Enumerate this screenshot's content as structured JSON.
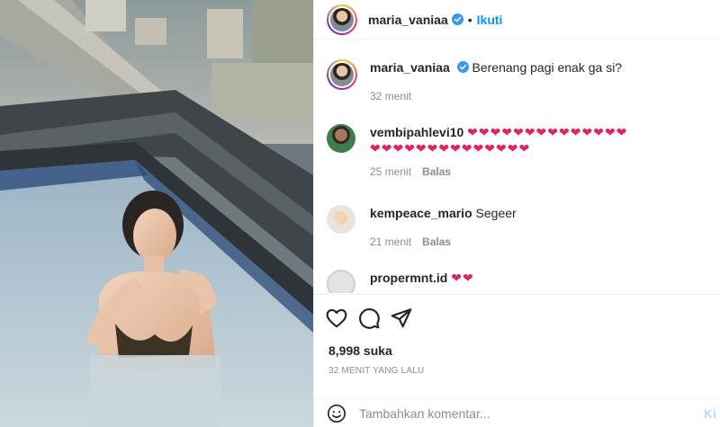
{
  "header": {
    "username": "maria_vaniaa",
    "separator": "•",
    "follow_label": "Ikuti"
  },
  "caption": {
    "username": "maria_vaniaa",
    "text": "Berenang pagi enak ga si?",
    "time": "32 menit"
  },
  "comments": [
    {
      "username": "vembipahlevi10",
      "text": "❤❤❤❤❤❤❤❤❤❤❤❤❤❤❤❤❤❤❤❤❤❤❤❤❤❤❤❤❤❤❤❤❤❤❤❤❤❤❤❤❤❤❤❤❤❤❤❤❤❤❤❤❤❤❤❤❤❤❤❤❤❤❤❤",
      "line1": "❤❤❤❤❤❤❤❤❤❤❤❤❤❤❤❤❤❤❤❤❤❤❤❤❤❤❤❤❤❤❤❤❤❤❤❤❤❤❤❤❤❤❤❤❤❤❤❤❤❤❤❤❤❤❤❤❤❤❤❤❤❤❤❤",
      "line2": "❤❤❤❤❤❤❤❤❤❤❤❤❤❤❤❤❤❤❤❤❤❤❤❤❤❤❤❤❤❤❤❤❤❤❤❤❤❤❤❤❤❤❤❤❤❤❤❤❤❤❤❤❤❤❤❤❤❤❤❤❤❤❤❤",
      "time": "25 menit",
      "reply": "Balas"
    },
    {
      "username": "kempeace_mario",
      "text": "Segeer",
      "time": "21 menit",
      "reply": "Balas"
    },
    {
      "username": "propermnt.id",
      "text": "❤❤"
    }
  ],
  "likes": "8,998 suka",
  "post_time": "32 MENIT YANG LALU",
  "composer": {
    "placeholder": "Tambahkan komentar...",
    "post_label": "Ki"
  },
  "icons": {
    "verified": "verified-badge-icon",
    "like": "heart-icon",
    "comment": "comment-bubble-icon",
    "share": "paper-plane-icon",
    "emoji": "emoji-icon"
  },
  "colors": {
    "accent": "#0095f6",
    "verified": "#3897f0",
    "heart": "#e0245e"
  }
}
